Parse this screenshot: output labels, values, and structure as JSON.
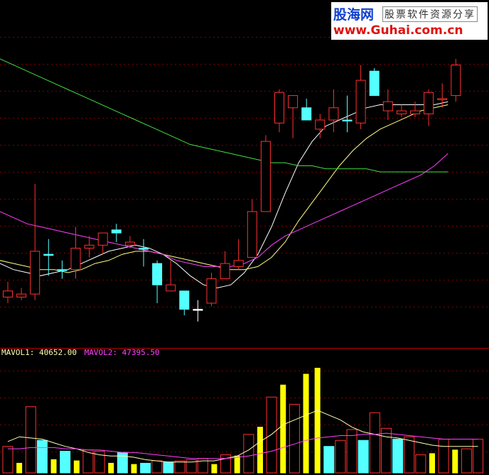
{
  "chart_data": {
    "type": "candlestick",
    "price_panel": {
      "candles": [
        {
          "o": 12.4,
          "h": 12.7,
          "l": 12.0,
          "c": 12.2,
          "color": "red-hollow"
        },
        {
          "o": 12.3,
          "h": 12.5,
          "l": 12.1,
          "c": 12.2,
          "color": "red-hollow"
        },
        {
          "o": 12.3,
          "h": 15.9,
          "l": 12.1,
          "c": 13.7,
          "color": "red-hollow"
        },
        {
          "o": 13.6,
          "h": 14.1,
          "l": 12.9,
          "c": 13.6,
          "color": "cyan"
        },
        {
          "o": 13.1,
          "h": 13.4,
          "l": 12.8,
          "c": 13.1,
          "color": "cyan"
        },
        {
          "o": 13.1,
          "h": 14.5,
          "l": 12.8,
          "c": 13.8,
          "color": "red-hollow"
        },
        {
          "o": 13.8,
          "h": 14.2,
          "l": 13.5,
          "c": 13.9,
          "color": "red-hollow"
        },
        {
          "o": 13.9,
          "h": 14.3,
          "l": 13.6,
          "c": 14.3,
          "color": "red-hollow"
        },
        {
          "o": 14.4,
          "h": 14.6,
          "l": 14.0,
          "c": 14.3,
          "color": "cyan"
        },
        {
          "o": 13.9,
          "h": 14.2,
          "l": 13.8,
          "c": 14.0,
          "color": "red-hollow"
        },
        {
          "o": 13.8,
          "h": 14.1,
          "l": 13.2,
          "c": 13.8,
          "color": "cyan"
        },
        {
          "o": 13.3,
          "h": 13.4,
          "l": 12.0,
          "c": 12.6,
          "color": "cyan"
        },
        {
          "o": 12.4,
          "h": 13.4,
          "l": 12.4,
          "c": 12.6,
          "color": "red-hollow"
        },
        {
          "o": 12.4,
          "h": 12.4,
          "l": 11.6,
          "c": 11.8,
          "color": "cyan"
        },
        {
          "o": 11.8,
          "h": 12.1,
          "l": 11.4,
          "c": 11.8,
          "color": "white-doji"
        },
        {
          "o": 12.0,
          "h": 13.0,
          "l": 11.9,
          "c": 12.8,
          "color": "red-hollow"
        },
        {
          "o": 12.8,
          "h": 13.7,
          "l": 12.8,
          "c": 13.3,
          "color": "red-hollow"
        },
        {
          "o": 13.2,
          "h": 14.1,
          "l": 13.1,
          "c": 13.4,
          "color": "red-hollow"
        },
        {
          "o": 13.5,
          "h": 15.4,
          "l": 13.5,
          "c": 15.0,
          "color": "red-hollow"
        },
        {
          "o": 15.0,
          "h": 17.5,
          "l": 15.0,
          "c": 17.3,
          "color": "red-hollow"
        },
        {
          "o": 17.9,
          "h": 19.0,
          "l": 17.6,
          "c": 18.9,
          "color": "red-hollow"
        },
        {
          "o": 18.4,
          "h": 18.8,
          "l": 17.4,
          "c": 18.8,
          "color": "red-hollow"
        },
        {
          "o": 18.4,
          "h": 18.7,
          "l": 18.0,
          "c": 18.0,
          "color": "cyan"
        },
        {
          "o": 17.7,
          "h": 18.2,
          "l": 17.4,
          "c": 18.0,
          "color": "red-hollow"
        },
        {
          "o": 18.0,
          "h": 19.0,
          "l": 17.6,
          "c": 18.4,
          "color": "red-hollow"
        },
        {
          "o": 18.0,
          "h": 18.8,
          "l": 17.6,
          "c": 18.0,
          "color": "cyan"
        },
        {
          "o": 17.9,
          "h": 19.8,
          "l": 17.7,
          "c": 19.3,
          "color": "red-hollow"
        },
        {
          "o": 19.6,
          "h": 19.7,
          "l": 18.8,
          "c": 18.8,
          "color": "cyan"
        },
        {
          "o": 18.6,
          "h": 19.0,
          "l": 18.0,
          "c": 18.3,
          "color": "red-hollow"
        },
        {
          "o": 18.2,
          "h": 18.5,
          "l": 18.1,
          "c": 18.3,
          "color": "red-hollow"
        },
        {
          "o": 18.2,
          "h": 18.6,
          "l": 18.1,
          "c": 18.3,
          "color": "red-hollow"
        },
        {
          "o": 18.2,
          "h": 19.0,
          "l": 17.8,
          "c": 18.9,
          "color": "red-hollow"
        },
        {
          "o": 18.7,
          "h": 19.2,
          "l": 18.4,
          "c": 18.7,
          "color": "red-hollow"
        },
        {
          "o": 18.8,
          "h": 20.0,
          "l": 18.6,
          "c": 19.8,
          "color": "red-hollow"
        }
      ],
      "ma_lines": [
        {
          "color": "#ffffff",
          "values": [
            13.3,
            13.1,
            13.0,
            12.9,
            13.0,
            13.1,
            13.3,
            13.5,
            13.7,
            13.8,
            13.9,
            13.8,
            13.6,
            13.3,
            12.9,
            12.6,
            12.5,
            12.6,
            13.0,
            13.6,
            14.5,
            15.6,
            16.6,
            17.3,
            17.8,
            18.0,
            18.2,
            18.4,
            18.5,
            18.5,
            18.5,
            18.5,
            18.5,
            18.6
          ]
        },
        {
          "color": "#ffff80",
          "values": [
            13.4,
            13.3,
            13.2,
            13.1,
            13.1,
            13.0,
            13.1,
            13.3,
            13.4,
            13.6,
            13.7,
            13.7,
            13.6,
            13.5,
            13.4,
            13.3,
            13.2,
            13.1,
            13.1,
            13.2,
            13.5,
            14.0,
            14.7,
            15.3,
            15.9,
            16.5,
            17.0,
            17.4,
            17.7,
            17.9,
            18.1,
            18.3,
            18.4,
            18.5
          ]
        },
        {
          "color": "#ff40ff",
          "values": [
            15.0,
            14.8,
            14.6,
            14.5,
            14.4,
            14.3,
            14.2,
            14.1,
            14.0,
            13.9,
            13.8,
            13.7,
            13.6,
            13.4,
            13.3,
            13.2,
            13.2,
            13.2,
            13.3,
            13.5,
            13.9,
            14.2,
            14.4,
            14.6,
            14.8,
            15.0,
            15.2,
            15.4,
            15.6,
            15.8,
            16.0,
            16.2,
            16.5,
            16.9
          ]
        },
        {
          "color": "#40e040",
          "values": [
            20.0,
            19.8,
            19.6,
            19.4,
            19.2,
            19.0,
            18.8,
            18.6,
            18.4,
            18.2,
            18.0,
            17.8,
            17.6,
            17.4,
            17.2,
            17.1,
            17.0,
            16.9,
            16.8,
            16.7,
            16.6,
            16.6,
            16.5,
            16.5,
            16.4,
            16.4,
            16.4,
            16.4,
            16.3,
            16.3,
            16.3,
            16.3,
            16.3,
            16.3
          ]
        }
      ],
      "ylim": [
        11.0,
        21.0
      ]
    },
    "volume_panel": {
      "mavol1_label": "MAVOL1:",
      "mavol1_value": "40652.00",
      "mavol2_label": "MAVOL2:",
      "mavol2_value": "47395.50",
      "bars": [
        {
          "v": 22000,
          "color": "red-hollow"
        },
        {
          "v": 8000,
          "color": "yellow"
        },
        {
          "v": 55000,
          "color": "red-hollow"
        },
        {
          "v": 27000,
          "color": "cyan"
        },
        {
          "v": 11000,
          "color": "yellow"
        },
        {
          "v": 18000,
          "color": "cyan"
        },
        {
          "v": 10000,
          "color": "yellow"
        },
        {
          "v": 19000,
          "color": "red-hollow"
        },
        {
          "v": 18000,
          "color": "red-hollow"
        },
        {
          "v": 8000,
          "color": "yellow"
        },
        {
          "v": 17000,
          "color": "cyan"
        },
        {
          "v": 7000,
          "color": "yellow"
        },
        {
          "v": 8000,
          "color": "cyan"
        },
        {
          "v": 10000,
          "color": "red-hollow"
        },
        {
          "v": 9000,
          "color": "cyan"
        },
        {
          "v": 10000,
          "color": "red-hollow"
        },
        {
          "v": 11000,
          "color": "red-hollow"
        },
        {
          "v": 12000,
          "color": "red-hollow"
        },
        {
          "v": 7000,
          "color": "yellow"
        },
        {
          "v": 15000,
          "color": "red-hollow"
        },
        {
          "v": 14000,
          "color": "yellow"
        },
        {
          "v": 32000,
          "color": "red-hollow"
        },
        {
          "v": 38000,
          "color": "yellow"
        },
        {
          "v": 63000,
          "color": "red-hollow"
        },
        {
          "v": 73000,
          "color": "yellow"
        },
        {
          "v": 57000,
          "color": "red-hollow"
        },
        {
          "v": 82000,
          "color": "yellow"
        },
        {
          "v": 87000,
          "color": "yellow"
        },
        {
          "v": 22000,
          "color": "cyan"
        },
        {
          "v": 27000,
          "color": "red-hollow"
        },
        {
          "v": 36000,
          "color": "red-hollow"
        },
        {
          "v": 27000,
          "color": "cyan"
        },
        {
          "v": 50000,
          "color": "red-hollow"
        },
        {
          "v": 37000,
          "color": "red-hollow"
        },
        {
          "v": 28000,
          "color": "cyan"
        },
        {
          "v": 30000,
          "color": "red-hollow"
        },
        {
          "v": 15000,
          "color": "red-hollow"
        },
        {
          "v": 16000,
          "color": "yellow"
        },
        {
          "v": 28000,
          "color": "red-hollow"
        },
        {
          "v": 19000,
          "color": "yellow"
        },
        {
          "v": 20000,
          "color": "red-hollow"
        },
        {
          "v": 28000,
          "color": "red-hollow"
        }
      ],
      "mavol1_line": [
        26000,
        30000,
        29000,
        28000,
        25000,
        22000,
        20000,
        17000,
        15000,
        14000,
        14000,
        13000,
        11000,
        10000,
        9000,
        9000,
        9000,
        10000,
        10000,
        12000,
        14000,
        19000,
        26000,
        32000,
        40000,
        44000,
        48000,
        52000,
        48000,
        44000,
        38000,
        34000,
        32000,
        30000,
        29000,
        27000,
        25000,
        23000,
        22000,
        22000,
        22000,
        22000
      ],
      "mavol2_line": [
        20000,
        20000,
        21000,
        21000,
        21000,
        20000,
        20000,
        19000,
        19000,
        18000,
        17000,
        17000,
        16000,
        15000,
        14000,
        13000,
        12000,
        12000,
        12000,
        12000,
        13000,
        14000,
        16000,
        18000,
        21000,
        24000,
        27000,
        29000,
        30000,
        31000,
        31000,
        32000,
        32000,
        33000,
        32000,
        31000,
        30000,
        29000,
        28000,
        28000,
        28000,
        28000
      ],
      "ylim": [
        0,
        95000
      ]
    }
  },
  "logo": {
    "name_cn": "股海网",
    "slogan": "股票软件资源分享",
    "url": "www.Guhai.com.cn"
  },
  "colors": {
    "background": "#000000",
    "up": "#ff3030",
    "down": "#54ffff",
    "volume_big": "#ffff00",
    "grid": "#800000",
    "divider": "#c00000"
  }
}
